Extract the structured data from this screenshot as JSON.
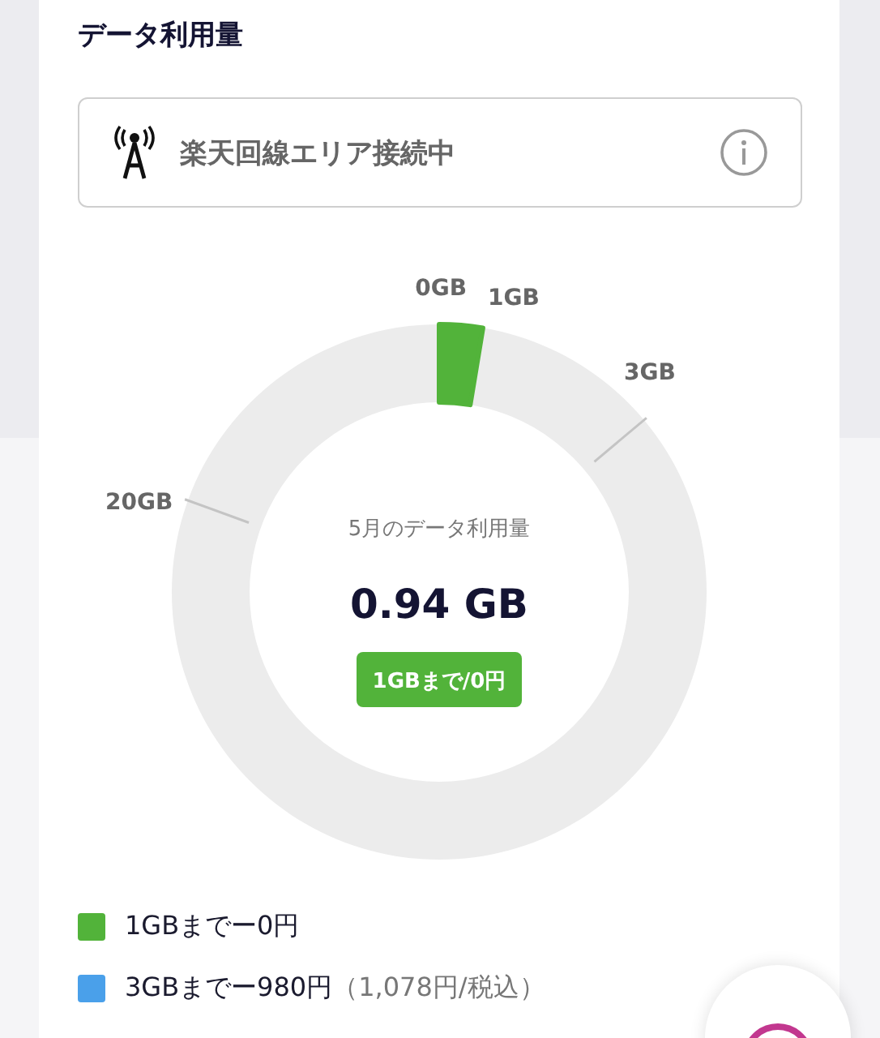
{
  "title": "データ利用量",
  "connection": {
    "text": "楽天回線エリア接続中"
  },
  "gauge": {
    "caption": "5月のデータ利用量",
    "usage": "0.94 GB",
    "badge": "1GBまで/0円",
    "ticks": [
      "0GB",
      "1GB",
      "3GB",
      "20GB"
    ]
  },
  "legend": [
    {
      "text": "1GBまでー0円",
      "color": "#52b33a"
    },
    {
      "text": "3GBまでー980円",
      "note": "（1,078円/税込）",
      "color": "#4aa0ea"
    }
  ]
}
